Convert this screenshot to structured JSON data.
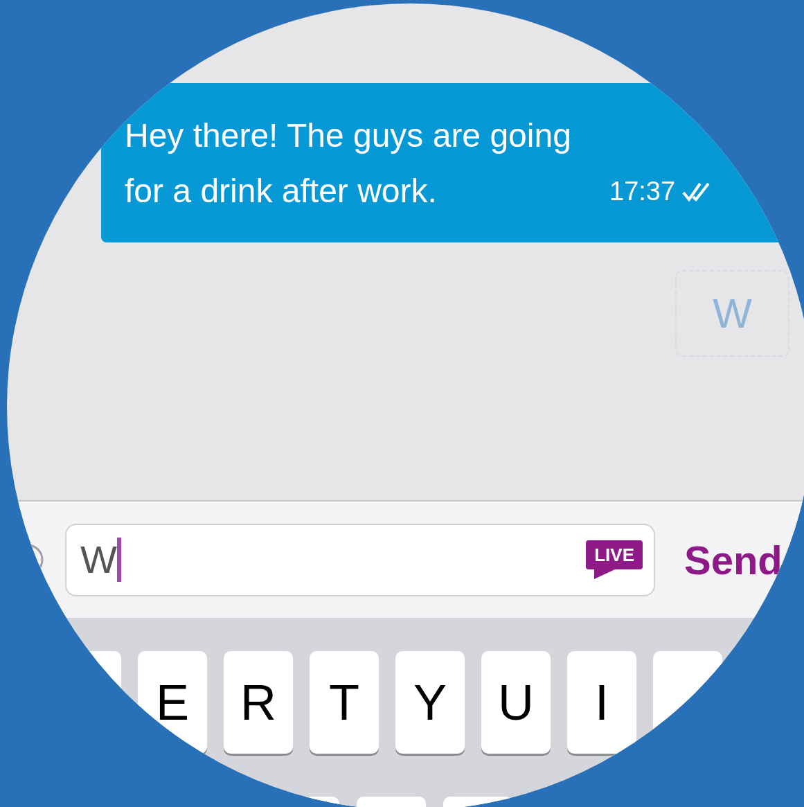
{
  "message": {
    "text": "Hey there! The guys are going for a drink after work.",
    "time": "17:37",
    "read": true
  },
  "key_preview": "W",
  "composer": {
    "value": "W",
    "badge": "LIVE",
    "send": "Send"
  },
  "keyboard": {
    "keys": [
      "E",
      "R",
      "T",
      "Y",
      "U",
      "I"
    ]
  }
}
